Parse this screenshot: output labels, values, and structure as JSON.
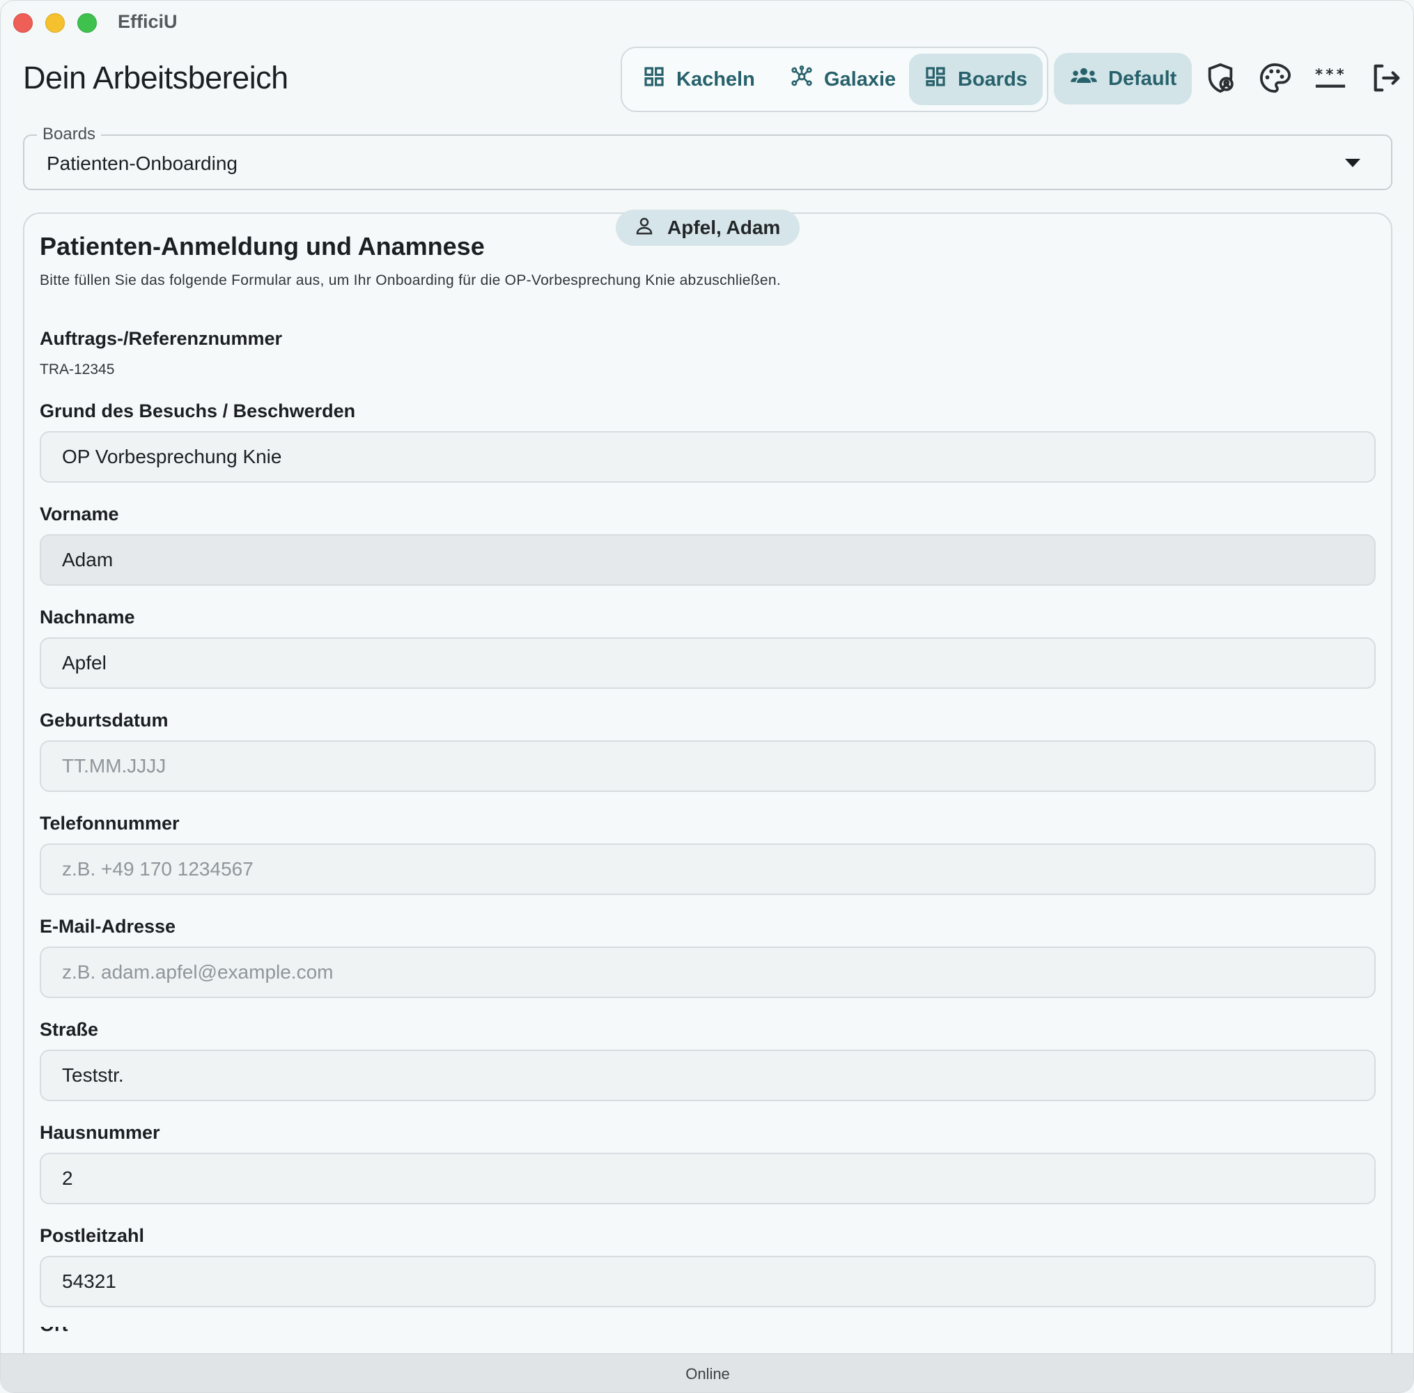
{
  "window": {
    "app_title": "EfficiU"
  },
  "header": {
    "title": "Dein Arbeitsbereich",
    "view_switch": [
      {
        "label": "Kacheln",
        "icon": "grid-icon",
        "active": false
      },
      {
        "label": "Galaxie",
        "icon": "galaxy-icon",
        "active": false
      },
      {
        "label": "Boards",
        "icon": "boards-icon",
        "active": true
      }
    ],
    "profile_button": {
      "label": "Default",
      "icon": "group-icon"
    },
    "icons": [
      "shield-user-icon",
      "palette-icon",
      "password-icon",
      "logout-icon"
    ]
  },
  "boards": {
    "legend": "Boards",
    "value": "Patienten-Onboarding"
  },
  "form": {
    "user_chip": "Apfel, Adam",
    "title": "Patienten-Anmeldung und Anamnese",
    "subtitle": "Bitte füllen Sie das folgende Formular aus, um Ihr Onboarding für die OP-Vorbesprechung Knie abzuschließen.",
    "reference": {
      "label": "Auftrags-/Referenznummer",
      "value": "TRA-12345"
    },
    "fields": {
      "reason": {
        "label": "Grund des Besuchs / Beschwerden",
        "value": "OP Vorbesprechung Knie",
        "placeholder": ""
      },
      "first_name": {
        "label": "Vorname",
        "value": "Adam",
        "placeholder": ""
      },
      "last_name": {
        "label": "Nachname",
        "value": "Apfel",
        "placeholder": ""
      },
      "birthdate": {
        "label": "Geburtsdatum",
        "value": "",
        "placeholder": "TT.MM.JJJJ"
      },
      "phone": {
        "label": "Telefonnummer",
        "value": "",
        "placeholder": "z.B. +49 170 1234567"
      },
      "email": {
        "label": "E-Mail-Adresse",
        "value": "",
        "placeholder": "z.B. adam.apfel@example.com"
      },
      "street": {
        "label": "Straße",
        "value": "Teststr.",
        "placeholder": ""
      },
      "house_number": {
        "label": "Hausnummer",
        "value": "2",
        "placeholder": ""
      },
      "postal_code": {
        "label": "Postleitzahl",
        "value": "54321",
        "placeholder": ""
      }
    },
    "next_label_partial": "Ort"
  },
  "status": {
    "text": "Online"
  },
  "colors": {
    "accent": "#27616b",
    "accent_bg": "#d2e4e8",
    "background": "#f4f8f9"
  }
}
